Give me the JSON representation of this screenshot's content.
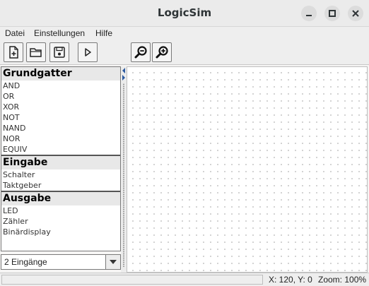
{
  "window": {
    "title": "LogicSim"
  },
  "menubar": {
    "items": [
      "Datei",
      "Einstellungen",
      "Hilfe"
    ]
  },
  "toolbar": {
    "buttons": [
      "new-file-icon",
      "open-folder-icon",
      "save-disk-icon",
      "run-play-icon",
      "zoom-out-icon",
      "zoom-in-icon"
    ]
  },
  "palette": {
    "groups": [
      {
        "title": "Grundgatter",
        "items": [
          "AND",
          "OR",
          "XOR",
          "NOT",
          "NAND",
          "NOR",
          "EQUIV"
        ]
      },
      {
        "title": "Eingabe",
        "items": [
          "Schalter",
          "Taktgeber"
        ]
      },
      {
        "title": "Ausgabe",
        "items": [
          "LED",
          "Zähler",
          "Binärdisplay"
        ]
      }
    ]
  },
  "inputs_combo": {
    "value": "2 Eingänge"
  },
  "statusbar": {
    "coords": "X: 120, Y: 0",
    "zoom": "Zoom: 100%"
  }
}
